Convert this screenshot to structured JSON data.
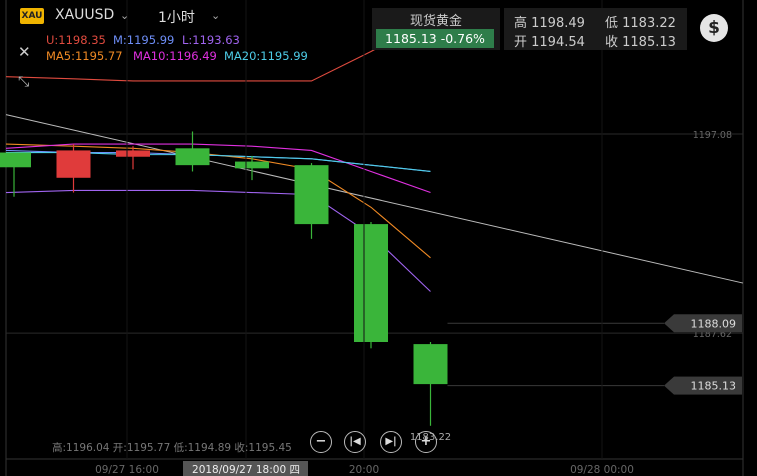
{
  "header": {
    "logo_text": "XAU",
    "symbol": "XAUUSD",
    "period": "1小时",
    "close_icon": "close-icon",
    "expand_icon": "expand-icon",
    "chevron_icon": "chevron-down-icon"
  },
  "indicators": {
    "upper": "U:1198.35",
    "middle": "M:1195.99",
    "lower": "L:1193.63",
    "ma5": "MA5:1195.77",
    "ma10": "MA10:1196.49",
    "ma20": "MA20:1195.99"
  },
  "quote": {
    "name": "现货黄金",
    "price_change": "1185.13   -0.76%",
    "high": "高 1198.49",
    "low": "低 1183.22",
    "open": "开 1194.54",
    "close": "收 1185.13",
    "currency_icon": "dollar-coin-icon"
  },
  "footer": {
    "ohlc": "高:1196.04 开:1195.77 低:1194.89 收:1195.45",
    "controls": [
      "zoom-out-button",
      "first-button",
      "last-button",
      "zoom-in-button"
    ]
  },
  "colors": {
    "up": "#3ab53a",
    "down": "#e03b3b",
    "upper_band": "#e04b3f",
    "middle_band": "#6e8ef7",
    "lower_band": "#a064f0",
    "ma5": "#f08a24",
    "ma10": "#e030e0",
    "ma20": "#4ecde8",
    "trendline": "#bbbbbb",
    "price_line_bg": "#3a3a3a"
  },
  "chart_data": {
    "type": "candlestick",
    "ylim": [
      1181.5,
      1200.5
    ],
    "x_ticks": [
      "09/27 16:00",
      "2018/09/27 18:00 四",
      "20:00",
      "09/28 00:00"
    ],
    "y_ticks": [
      "1197.08",
      "1187.62"
    ],
    "price_labels": [
      "1188.09",
      "1185.13"
    ],
    "low_label": "1183.22",
    "candles": [
      {
        "o": 1195.5,
        "h": 1196.2,
        "l": 1194.1,
        "c": 1196.2
      },
      {
        "o": 1196.3,
        "h": 1196.6,
        "l": 1194.3,
        "c": 1195.0
      },
      {
        "o": 1196.3,
        "h": 1196.5,
        "l": 1195.4,
        "c": 1196.0
      },
      {
        "o": 1195.6,
        "h": 1197.2,
        "l": 1195.3,
        "c": 1196.4
      },
      {
        "o": 1195.45,
        "h": 1196.04,
        "l": 1194.89,
        "c": 1195.77
      },
      {
        "o": 1192.8,
        "h": 1195.7,
        "l": 1192.1,
        "c": 1195.6
      },
      {
        "o": 1187.2,
        "h": 1192.9,
        "l": 1186.9,
        "c": 1192.8
      },
      {
        "o": 1185.2,
        "h": 1187.2,
        "l": 1183.22,
        "c": 1187.1
      }
    ],
    "series": [
      {
        "id": "upper",
        "values": [
          1199.8,
          1199.7,
          1199.6,
          1199.6,
          1199.6,
          1199.6,
          1201.0,
          1202.5
        ]
      },
      {
        "id": "middle",
        "values": [
          1196.3,
          1196.2,
          1196.2,
          1196.1,
          1196.0,
          1195.9,
          1195.6,
          1195.3
        ]
      },
      {
        "id": "lower",
        "values": [
          1194.3,
          1194.4,
          1194.4,
          1194.4,
          1194.3,
          1194.2,
          1192.3,
          1189.6
        ]
      },
      {
        "id": "ma5",
        "values": [
          1196.6,
          1196.5,
          1196.4,
          1196.2,
          1195.9,
          1195.4,
          1193.6,
          1191.2
        ]
      },
      {
        "id": "ma10",
        "values": [
          1196.4,
          1196.6,
          1196.6,
          1196.6,
          1196.5,
          1196.3,
          1195.3,
          1194.3
        ]
      },
      {
        "id": "ma20",
        "values": [
          1196.2,
          1196.2,
          1196.1,
          1196.1,
          1196.0,
          1195.9,
          1195.6,
          1195.3
        ]
      },
      {
        "id": "trendline",
        "values": [
          1198.0,
          1190.0
        ]
      }
    ]
  }
}
